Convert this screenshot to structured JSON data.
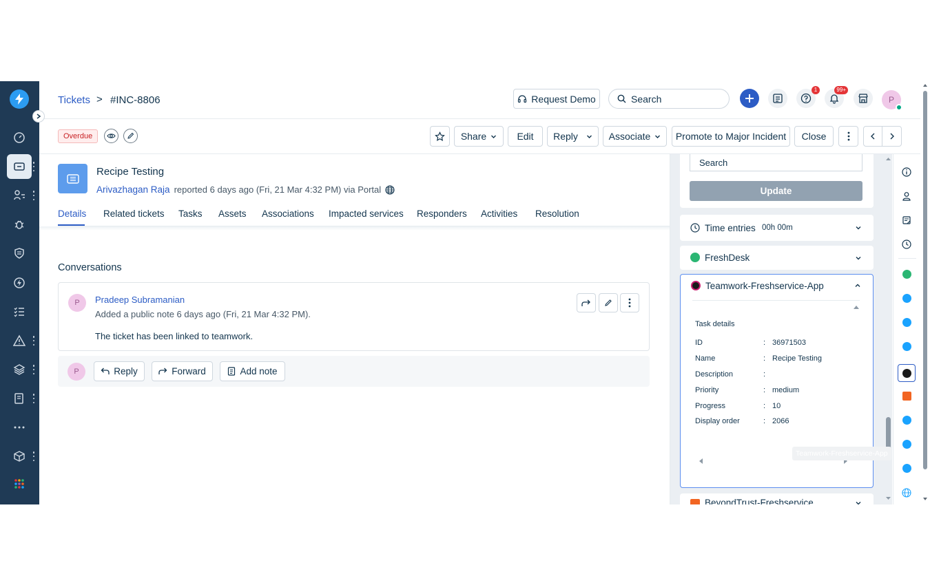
{
  "header": {
    "breadcrumb_link": "Tickets",
    "breadcrumb_sep": ">",
    "ticket_id": "#INC-8806",
    "request_demo_label": "Request Demo",
    "search_placeholder": "Search",
    "help_badge": "1",
    "notifications_badge": "99+",
    "avatar_initial": "P"
  },
  "toolbar": {
    "status_badge": "Overdue",
    "share_label": "Share",
    "edit_label": "Edit",
    "reply_label": "Reply",
    "associate_label": "Associate",
    "promote_label": "Promote to Major Incident",
    "close_label": "Close"
  },
  "ticket": {
    "title": "Recipe Testing",
    "requester": "Arivazhagan Raja",
    "meta": "reported 6 days ago (Fri, 21 Mar 4:32 PM) via Portal"
  },
  "tabs": [
    {
      "label": "Details",
      "active": true
    },
    {
      "label": "Related tickets"
    },
    {
      "label": "Tasks"
    },
    {
      "label": "Assets"
    },
    {
      "label": "Associations"
    },
    {
      "label": "Impacted services"
    },
    {
      "label": "Responders"
    },
    {
      "label": "Activities"
    },
    {
      "label": "Resolution"
    }
  ],
  "conversations": {
    "heading": "Conversations",
    "items": [
      {
        "avatar": "P",
        "author": "Pradeep Subramanian",
        "subtitle": "Added a public note 6 days ago (Fri, 21 Mar 4:32 PM).",
        "body": "The ticket has been linked to teamwork."
      }
    ],
    "reply_bar": {
      "avatar": "P",
      "reply_label": "Reply",
      "forward_label": "Forward",
      "add_note_label": "Add note"
    }
  },
  "right_panel": {
    "search_value": "Search",
    "update_label": "Update",
    "time_entries_label": "Time entries",
    "time_entries_value": "00h 00m",
    "freshdesk_label": "FreshDesk",
    "teamwork_label": "Teamwork-Freshservice-App",
    "task_details_heading": "Task details",
    "task_fields": [
      {
        "label": "ID",
        "value": "36971503"
      },
      {
        "label": "Name",
        "value": "Recipe Testing"
      },
      {
        "label": "Description",
        "value": ""
      },
      {
        "label": "Priority",
        "value": "medium"
      },
      {
        "label": "Progress",
        "value": "10"
      },
      {
        "label": "Display order",
        "value": "2066"
      }
    ],
    "beyondtrust_label": "BeyondTrust-Freshservice",
    "tooltip": "Teamwork-Freshservice-App"
  },
  "colors": {
    "nav_bg": "#1f3a55",
    "link": "#2c5cc5",
    "freshdesk_green": "#2bb673",
    "beyondtrust_orange": "#f26522",
    "freshservice_blue": "#1aa3ff"
  }
}
